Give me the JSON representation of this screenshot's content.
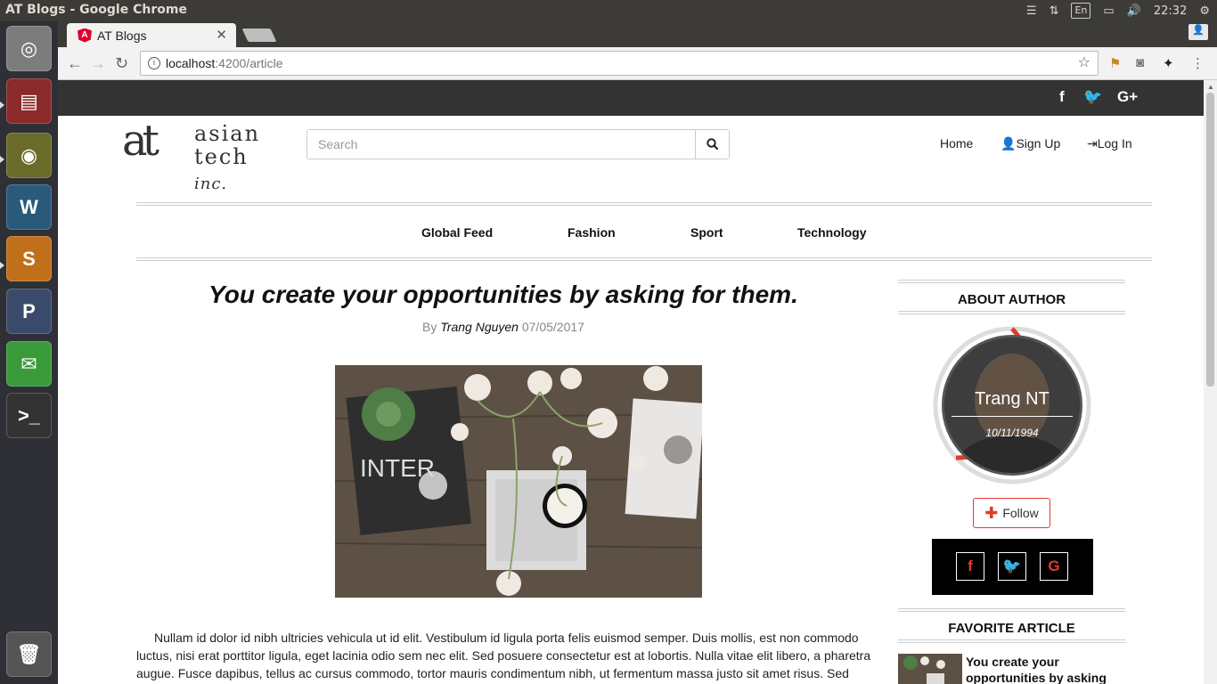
{
  "os": {
    "window_title": "AT Blogs - Google Chrome",
    "tray": {
      "keyboard": "En",
      "time": "22:32"
    },
    "launcher": [
      {
        "name": "ubuntu-dash-icon",
        "color": "#7c7c7c",
        "glyph": "◎"
      },
      {
        "name": "files-icon",
        "color": "#8a2a2a",
        "glyph": "▤"
      },
      {
        "name": "chrome-icon",
        "color": "#6a6a2a",
        "glyph": "◉"
      },
      {
        "name": "mysql-workbench-icon",
        "color": "#2a5a7a",
        "glyph": "W"
      },
      {
        "name": "sublime-text-icon",
        "color": "#c0701a",
        "glyph": "S"
      },
      {
        "name": "postgresql-icon",
        "color": "#3a4a6a",
        "glyph": "P"
      },
      {
        "name": "whatsapp-icon",
        "color": "#3a9a3a",
        "glyph": "✉"
      },
      {
        "name": "terminal-icon",
        "color": "#333333",
        "glyph": ">_"
      },
      {
        "name": "trash-icon",
        "color": "#555555",
        "glyph": "🗑"
      }
    ]
  },
  "browser": {
    "tab_title": "AT Blogs",
    "url_host": "localhost",
    "url_path": ":4200/article"
  },
  "site": {
    "logo": {
      "mark": "at",
      "line1": "asian",
      "line2": "tech",
      "line2_suffix": "inc."
    },
    "search": {
      "placeholder": "Search"
    },
    "nav": {
      "home": "Home",
      "signup": "Sign Up",
      "login": "Log In"
    },
    "categories": [
      "Global Feed",
      "Fashion",
      "Sport",
      "Technology"
    ]
  },
  "article": {
    "title": "You create your opportunities by asking for them.",
    "by_label": "By",
    "author": "Trang Nguyen",
    "date": "07/05/2017",
    "body": "Nullam id dolor id nibh ultricies vehicula ut id elit. Vestibulum id ligula porta felis euismod semper. Duis mollis, est non commodo luctus, nisi erat porttitor ligula, eget lacinia odio sem nec elit. Sed posuere consectetur est at lobortis. Nulla vitae elit libero, a pharetra augue. Fusce dapibus, tellus ac cursus commodo, tortor mauris condimentum nibh, ut fermentum massa justo sit amet risus. Sed"
  },
  "sidebar": {
    "about_heading": "ABOUT AUTHOR",
    "author_name": "Trang NT",
    "author_dob": "10/11/1994",
    "follow_label": "Follow",
    "favorite_heading": "FAVORITE ARTICLE",
    "favorite_title": "You create your opportunities by asking",
    "accent": "#e03a2f"
  }
}
